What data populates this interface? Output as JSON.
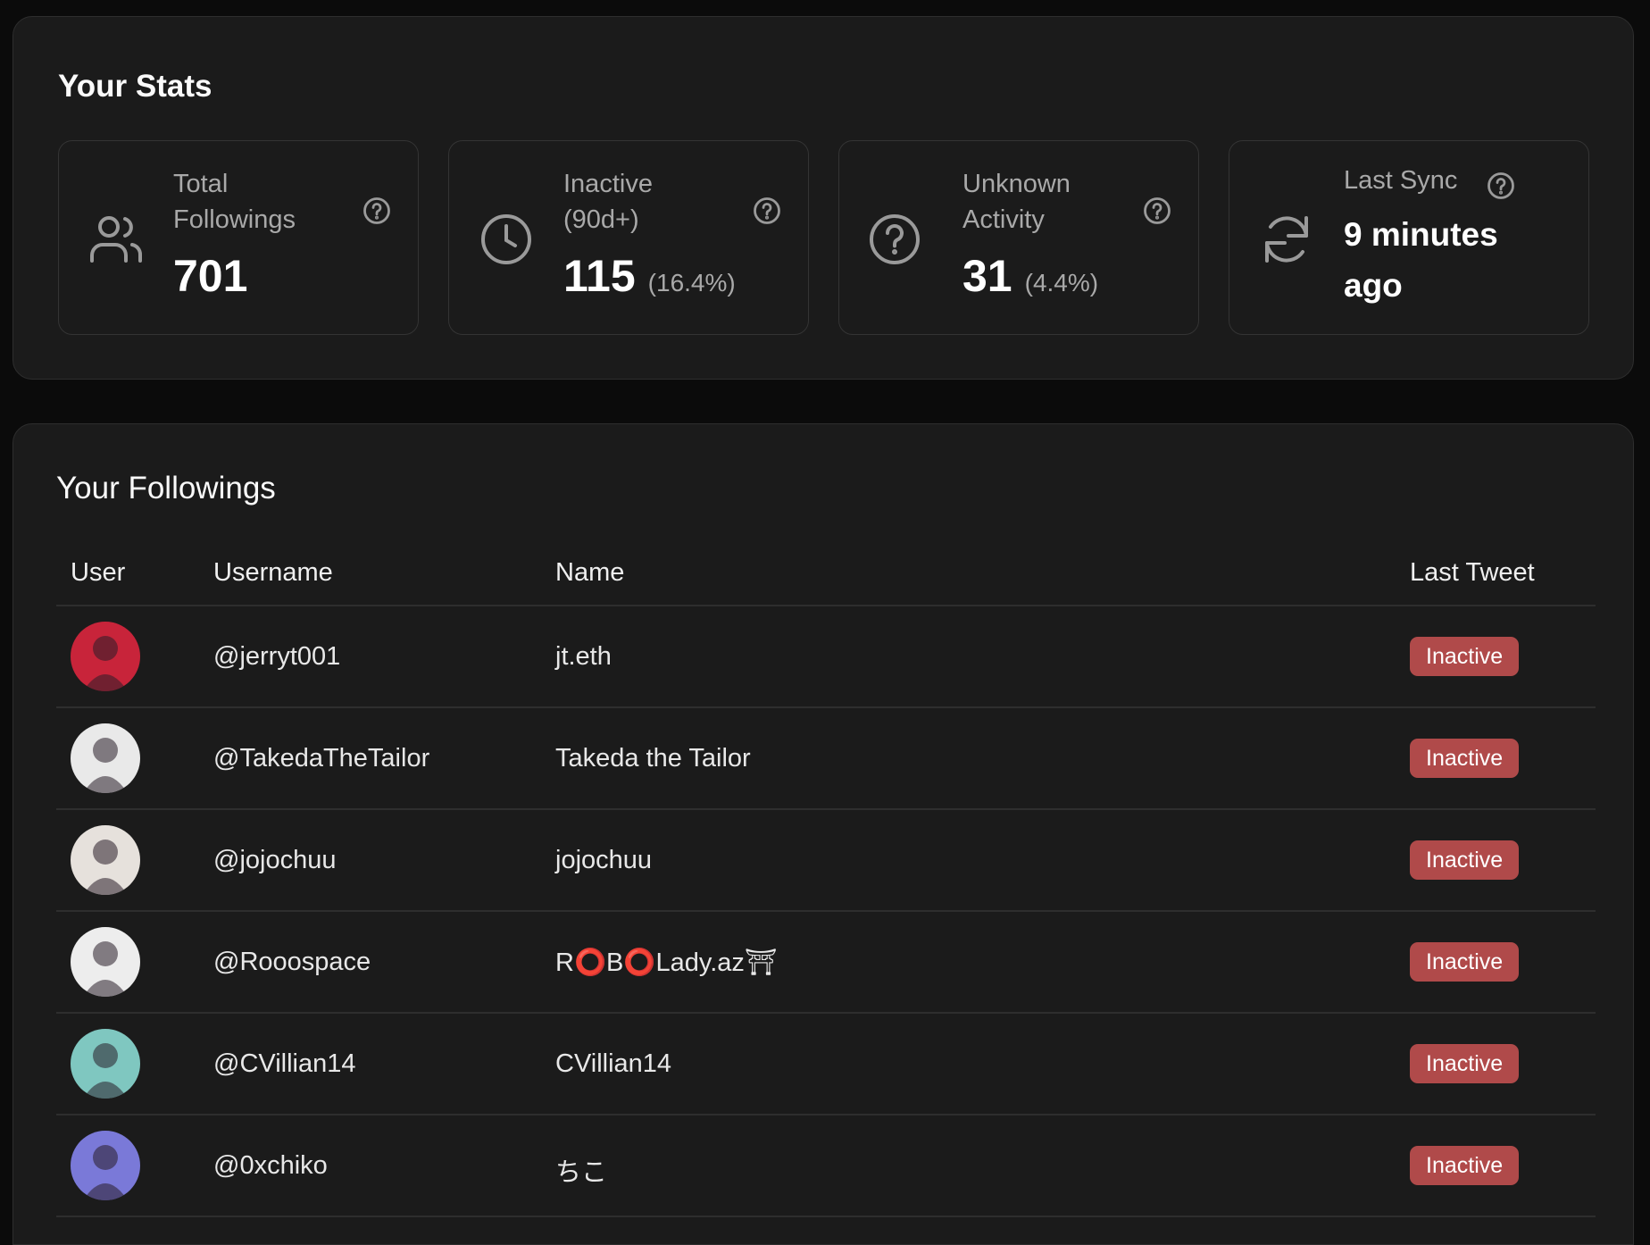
{
  "stats": {
    "title": "Your Stats",
    "total": {
      "label_line1": "Total",
      "label_line2": "Followings",
      "value": "701",
      "icon": "users-icon"
    },
    "inactive": {
      "label_line1": "Inactive",
      "label_line2": "(90d+)",
      "value": "115",
      "percent": "(16.4%)",
      "icon": "clock-icon"
    },
    "unknown": {
      "label_line1": "Unknown",
      "label_line2": "Activity",
      "value": "31",
      "percent": "(4.4%)",
      "icon": "question-circle-icon"
    },
    "sync": {
      "label": "Last Sync",
      "value_line1": "9 minutes",
      "value_line2": "ago",
      "icon": "refresh-icon"
    }
  },
  "followings": {
    "title": "Your Followings",
    "columns": {
      "user": "User",
      "username": "Username",
      "name": "Name",
      "last_tweet": "Last Tweet"
    },
    "rows": [
      {
        "username": "@jerryt001",
        "name": "jt.eth",
        "status": "Inactive",
        "avatar_bg": "#c8243a"
      },
      {
        "username": "@TakedaTheTailor",
        "name": "Takeda the Tailor",
        "status": "Inactive",
        "avatar_bg": "#e9e9e9"
      },
      {
        "username": "@jojochuu",
        "name": "jojochuu",
        "status": "Inactive",
        "avatar_bg": "#e6e1dc"
      },
      {
        "username": "@Rooospace",
        "name": "R⭕B⭕Lady.az⛩",
        "status": "Inactive",
        "avatar_bg": "#ededed"
      },
      {
        "username": "@CVillian14",
        "name": "CVillian14",
        "status": "Inactive",
        "avatar_bg": "#7fc7c0"
      },
      {
        "username": "@0xchiko",
        "name": "ちこ",
        "status": "Inactive",
        "avatar_bg": "#7a79d8"
      }
    ]
  },
  "colors": {
    "badge": "#b04a4a",
    "panel": "#1b1b1b",
    "background": "#0b0b0b"
  }
}
